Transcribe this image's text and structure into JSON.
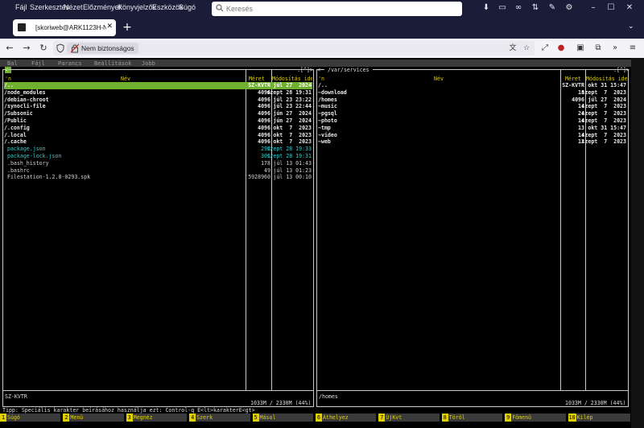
{
  "browser": {
    "menu": [
      "Fájl",
      "Szerkesztés",
      "Nézet",
      "Előzmények",
      "Könyvjelzők",
      "Eszközök",
      "Súgó"
    ],
    "search_placeholder": "Keresés",
    "tab_title": "[skoriweb@ARK1123H-NAS",
    "address_label": "Nem biztonságos"
  },
  "mc": {
    "menu": [
      "Bal",
      "Fájl",
      "Parancs",
      "Beállítások",
      "Jobb"
    ],
    "left": {
      "corner": "<─",
      "flags": ".[^]>",
      "col_name": "Név",
      "col_size": "Méret",
      "col_date": "Módosítás ideje",
      "col_sort": "'n",
      "rows": [
        {
          "name": "/..",
          "size": "SZ-KVTR",
          "date": "júl 27  2024",
          "kind": "sel"
        },
        {
          "name": "/node_modules",
          "size": "4096",
          "date": "szept 28 19:31",
          "kind": "dir"
        },
        {
          "name": "/debian-chroot",
          "size": "4096",
          "date": "júl 23 23:22",
          "kind": "dir"
        },
        {
          "name": "/synocli-file",
          "size": "4096",
          "date": "júl 23 22:44",
          "kind": "dir"
        },
        {
          "name": "/Subsonic",
          "size": "4096",
          "date": "jún 27  2024",
          "kind": "dir"
        },
        {
          "name": "/Public",
          "size": "4096",
          "date": "jún 27  2024",
          "kind": "dir"
        },
        {
          "name": "/.config",
          "size": "4096",
          "date": "okt  7  2023",
          "kind": "dir"
        },
        {
          "name": "/.local",
          "size": "4096",
          "date": "okt  7  2023",
          "kind": "dir"
        },
        {
          "name": "/.cache",
          "size": "4096",
          "date": "okt  7  2023",
          "kind": "dir"
        },
        {
          "name": " package.json",
          "size": "292",
          "date": "szept 28 19:33",
          "kind": "json"
        },
        {
          "name": " package-lock.json",
          "size": "301",
          "date": "szept 28 19:31",
          "kind": "json"
        },
        {
          "name": " .bash_history",
          "size": "178",
          "date": "júl 13 01:43",
          "kind": "file"
        },
        {
          "name": " .bashrc",
          "size": "49",
          "date": "júl 13 01:23",
          "kind": "file"
        },
        {
          "name": " Filestation-1.2.8-0293.spk",
          "size": "5928960",
          "date": "júl 13 00:10",
          "kind": "file"
        }
      ],
      "status": "SZ-KVTR",
      "free": "1033M / 2330M (44%)"
    },
    "right": {
      "path": " /var/services ",
      "flags": ".[^]>",
      "col_name": "Név",
      "col_size": "Méret",
      "col_date": "Módosítás ideje",
      "col_sort": "'n",
      "rows": [
        {
          "name": "/..",
          "size": "SZ-KVTR",
          "date": "okt 31 15:47",
          "kind": "dir"
        },
        {
          "name": "~download",
          "size": "18",
          "date": "szept  7  2023",
          "kind": "dir"
        },
        {
          "name": "/homes",
          "size": "4096",
          "date": "júl 27  2024",
          "kind": "dir"
        },
        {
          "name": "~music",
          "size": "14",
          "date": "szept  7  2023",
          "kind": "dir"
        },
        {
          "name": "~pgsql",
          "size": "24",
          "date": "szept  7  2023",
          "kind": "dir"
        },
        {
          "name": "~photo",
          "size": "14",
          "date": "szept  7  2023",
          "kind": "dir"
        },
        {
          "name": "~tmp",
          "size": "13",
          "date": "okt 31 15:47",
          "kind": "dir"
        },
        {
          "name": "~video",
          "size": "14",
          "date": "szept  7  2023",
          "kind": "dir"
        },
        {
          "name": "~web",
          "size": "12",
          "date": "szept  7  2023",
          "kind": "dir"
        }
      ],
      "status": "/homes",
      "free": "1033M / 2330M (44%)"
    },
    "hint": "Tipp: Speciális karakter beírásához használja ezt: Control-q E<lt>karakterE<gt>",
    "fkeys": [
      {
        "n": "1",
        "label": "Súgó"
      },
      {
        "n": "2",
        "label": "Menü"
      },
      {
        "n": "3",
        "label": "Megnéz"
      },
      {
        "n": "4",
        "label": "Szerk"
      },
      {
        "n": "5",
        "label": "Másol"
      },
      {
        "n": "6",
        "label": "Áthelyez"
      },
      {
        "n": "7",
        "label": "ÚjKvt"
      },
      {
        "n": "8",
        "label": "Töröl"
      },
      {
        "n": "9",
        "label": "Főmenü"
      },
      {
        "n": "10",
        "label": "Kilép"
      }
    ]
  }
}
